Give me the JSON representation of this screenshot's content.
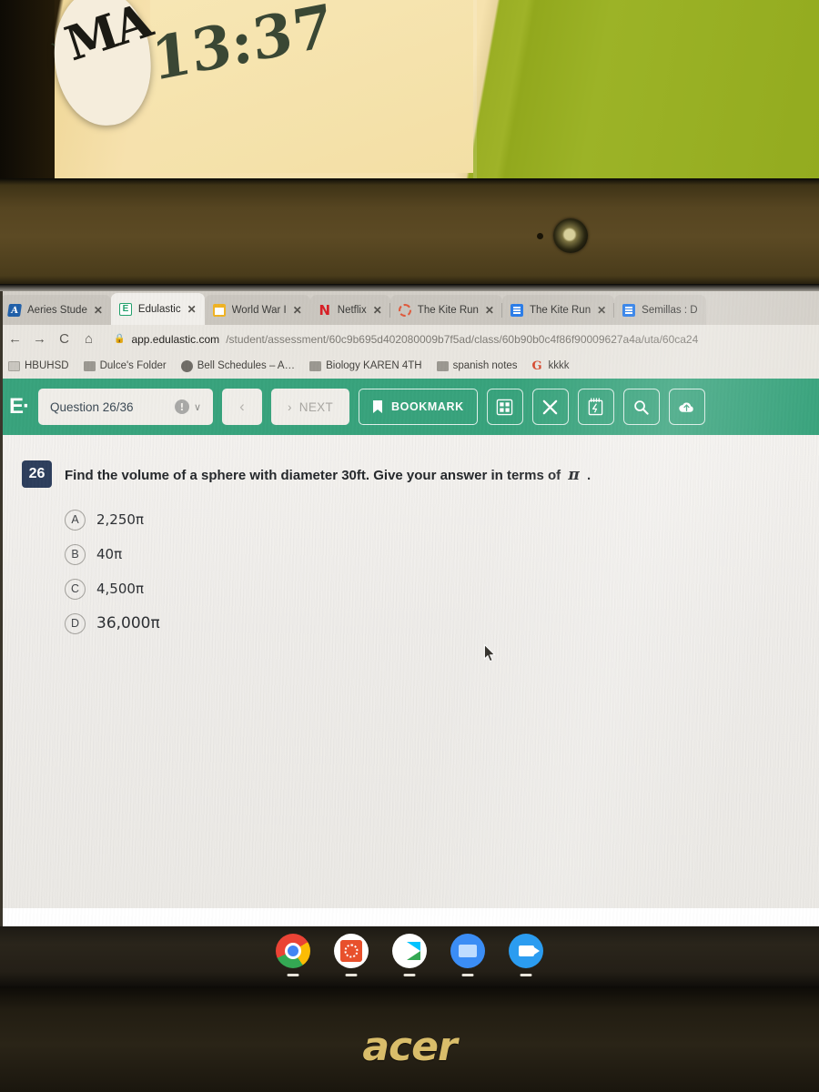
{
  "browser": {
    "tabs": [
      {
        "title": "Aeries Stude",
        "favicon": "aeries-icon",
        "active": false,
        "has_close": true
      },
      {
        "title": "Edulastic",
        "favicon": "edulastic-icon",
        "active": true,
        "has_close": true
      },
      {
        "title": "World War I",
        "favicon": "folder-icon",
        "active": false,
        "has_close": true
      },
      {
        "title": "Netflix",
        "favicon": "netflix-icon",
        "active": false,
        "has_close": true
      },
      {
        "title": "The Kite Run",
        "favicon": "loading-spinner-icon",
        "active": false,
        "has_close": true
      },
      {
        "title": "The Kite Run",
        "favicon": "google-docs-icon",
        "active": false,
        "has_close": true
      },
      {
        "title": "Semillas : D",
        "favicon": "google-docs-icon",
        "active": false,
        "has_close": false
      }
    ],
    "tab_close_label": "✕",
    "nav": {
      "back": "←",
      "forward": "→",
      "reload": "C",
      "home": "⌂"
    },
    "omnibox": {
      "lock_icon": "lock-icon",
      "host": "app.edulastic.com",
      "path": "/student/assessment/60c9b695d402080009b7f5ad/class/60b90b0c4f86f90009627a4a/uta/60ca24"
    },
    "bookmarks": [
      {
        "label": "HBUHSD",
        "icon": "page-icon"
      },
      {
        "label": "Dulce's Folder",
        "icon": "folder-icon"
      },
      {
        "label": "Bell Schedules – A…",
        "icon": "globe-icon"
      },
      {
        "label": "Biology KAREN 4TH",
        "icon": "folder-icon"
      },
      {
        "label": "spanish notes",
        "icon": "folder-icon"
      },
      {
        "label": "kkkk",
        "icon": "google-icon"
      }
    ]
  },
  "edulastic_toolbar": {
    "logo": "E·",
    "question_counter": "Question 26/36",
    "info_icon": "!",
    "dropdown_chevron": "∨",
    "prev_label": "‹",
    "next_arrow": "›",
    "next_label": "NEXT",
    "bookmark_label": "BOOKMARK",
    "bookmark_icon": "bookmark-flag-icon",
    "tools": [
      {
        "name": "calculator-icon"
      },
      {
        "name": "close-icon"
      },
      {
        "name": "scratchpad-icon"
      },
      {
        "name": "magnifier-icon"
      },
      {
        "name": "cloud-upload-icon"
      }
    ],
    "accent_color": "#38a37c"
  },
  "question": {
    "number": "26",
    "number_badge_color": "#2d3e5c",
    "prompt_before": "Find the volume of a sphere with diameter 30ft. Give your answer in terms of",
    "pi_symbol": "π",
    "prompt_after": ".",
    "choices": [
      {
        "letter": "A",
        "text": "2,250π"
      },
      {
        "letter": "B",
        "text": "40π"
      },
      {
        "letter": "C",
        "text": "4,500π"
      },
      {
        "letter": "D",
        "text": "36,000π"
      }
    ]
  },
  "shelf": {
    "apps": [
      {
        "name": "chrome-icon"
      },
      {
        "name": "red-app-icon"
      },
      {
        "name": "play-store-icon"
      },
      {
        "name": "files-icon"
      },
      {
        "name": "camera-icon"
      }
    ]
  },
  "laptop": {
    "brand": "acer"
  },
  "background": {
    "poster_text": "MA",
    "handwriting": "13:37",
    "wall_color": "#95ad22",
    "poster_color": "#f4e2ab"
  }
}
